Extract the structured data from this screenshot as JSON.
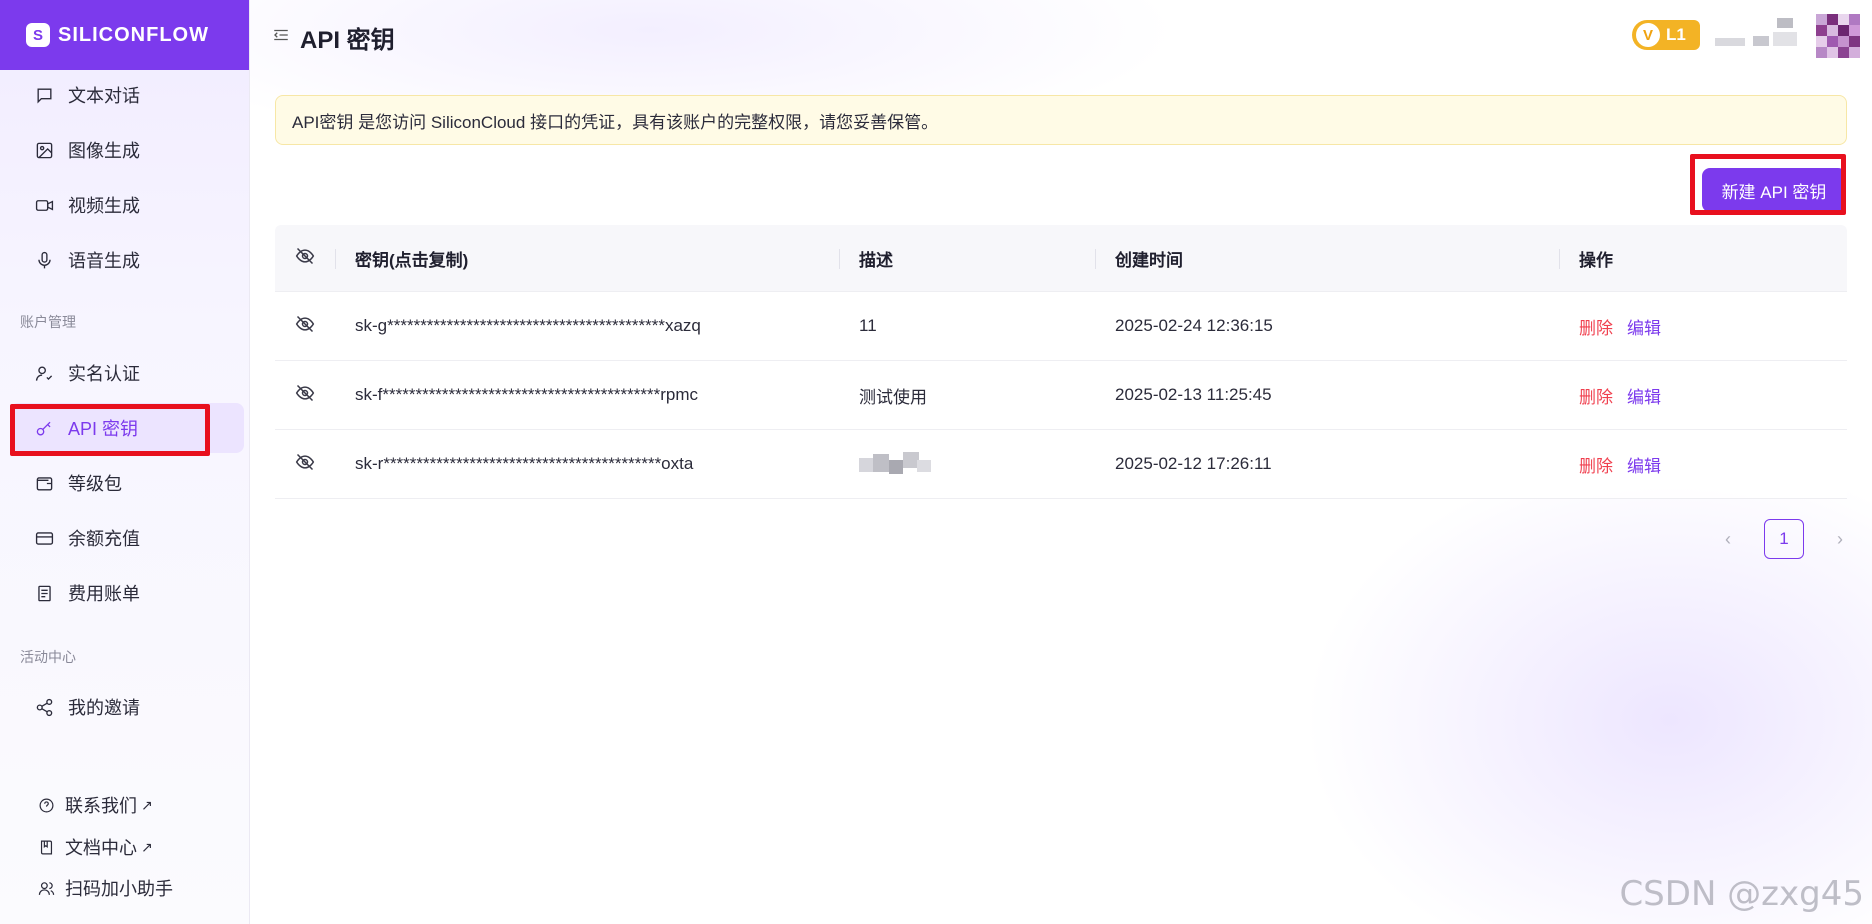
{
  "brand": {
    "name": "SILICONFLOW",
    "color": "#7c3aed"
  },
  "sidebar": {
    "items": [
      {
        "label": "文本对话",
        "icon": "chat-icon"
      },
      {
        "label": "图像生成",
        "icon": "image-icon"
      },
      {
        "label": "视频生成",
        "icon": "video-icon"
      },
      {
        "label": "语音生成",
        "icon": "mic-icon"
      }
    ],
    "account_section": "账户管理",
    "account_items": [
      {
        "label": "实名认证",
        "icon": "user-check-icon"
      },
      {
        "label": "API 密钥",
        "icon": "key-icon",
        "active": true
      },
      {
        "label": "等级包",
        "icon": "wallet-icon"
      },
      {
        "label": "余额充值",
        "icon": "credit-card-icon"
      },
      {
        "label": "费用账单",
        "icon": "bill-icon"
      }
    ],
    "activity_section": "活动中心",
    "activity_items": [
      {
        "label": "我的邀请",
        "icon": "share-icon"
      }
    ],
    "bottom_links": [
      {
        "label": "联系我们",
        "icon": "help-circle-icon",
        "external": "↗"
      },
      {
        "label": "文档中心",
        "icon": "book-icon",
        "external": "↗"
      },
      {
        "label": "扫码加小助手",
        "icon": "users-icon"
      }
    ]
  },
  "header": {
    "title": "API 密钥",
    "level_badge": {
      "v": "V",
      "level": "L1"
    }
  },
  "notice": "API密钥 是您访问 SiliconCloud 接口的凭证，具有该账户的完整权限，请您妥善保管。",
  "new_key_button": "新建 API 密钥",
  "table": {
    "columns": [
      "密钥(点击复制)",
      "描述",
      "创建时间",
      "操作"
    ],
    "rows": [
      {
        "key": "sk-g******************************************xazq",
        "desc": "11",
        "created": "2025-02-24 12:36:15"
      },
      {
        "key": "sk-f******************************************rpmc",
        "desc": "测试使用",
        "created": "2025-02-13 11:25:45"
      },
      {
        "key": "sk-r******************************************oxta",
        "desc": "",
        "desc_redacted": true,
        "created": "2025-02-12 17:26:11"
      }
    ],
    "actions": {
      "delete": "删除",
      "edit": "编辑"
    }
  },
  "pagination": {
    "prev": "‹",
    "current": "1",
    "next": "›"
  },
  "watermark": "CSDN @zxg45",
  "colors": {
    "accent": "#7c3aed",
    "danger": "#f0404f",
    "highlight": "#e8101e",
    "badge": "#f3b325"
  }
}
